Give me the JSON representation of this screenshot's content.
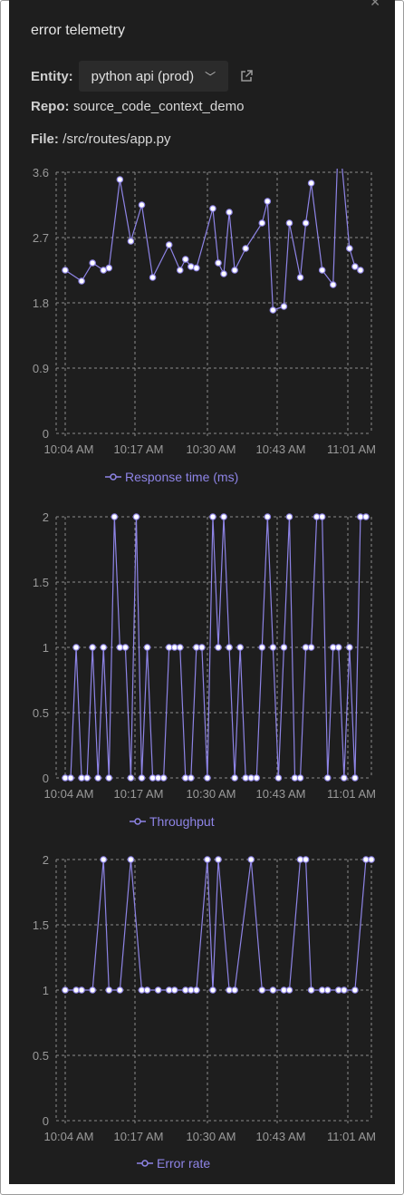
{
  "header": {
    "title": "error telemetry",
    "entity_label": "Entity:",
    "entity_value": "python api (prod)",
    "repo_label": "Repo:",
    "repo_value": "source_code_context_demo",
    "file_label": "File:",
    "file_value": "/src/routes/app.py"
  },
  "colors": {
    "series": "#8e84e6",
    "grid": "#8c8c8c",
    "text": "#9a9a9a",
    "background": "#1e1e1e"
  },
  "chart_data": [
    {
      "type": "line",
      "series": [
        {
          "name": "Response time (ms)",
          "x": [
            0,
            3,
            5,
            7,
            8,
            10,
            12,
            14,
            16,
            19,
            21,
            22,
            23,
            24,
            27,
            28,
            29,
            30,
            31,
            33,
            36,
            37,
            38,
            40,
            41,
            43,
            44,
            45,
            47,
            49,
            50,
            52,
            53,
            54
          ],
          "y": [
            2.25,
            2.1,
            2.35,
            2.25,
            2.28,
            3.5,
            2.65,
            3.15,
            2.15,
            2.6,
            2.25,
            2.4,
            2.3,
            2.28,
            3.1,
            2.35,
            2.2,
            3.05,
            2.25,
            2.55,
            2.9,
            3.2,
            1.7,
            1.75,
            2.9,
            2.15,
            2.9,
            3.45,
            2.25,
            2.05,
            4.2,
            2.55,
            2.3,
            2.25
          ]
        }
      ],
      "x_tick_labels": [
        "10:04 AM",
        "10:17 AM",
        "10:30 AM",
        "10:43 AM",
        "11:01 AM"
      ],
      "y_tick_labels": [
        "0",
        "0.9",
        "1.8",
        "2.7",
        "3.6"
      ],
      "ylim": [
        0,
        3.6
      ],
      "grid": true,
      "legend": "bottom"
    },
    {
      "type": "line",
      "series": [
        {
          "name": "Throughput",
          "x": [
            0,
            1,
            2,
            3,
            4,
            5,
            6,
            7,
            8,
            9,
            10,
            11,
            12,
            13,
            14,
            15,
            16,
            17,
            18,
            19,
            20,
            21,
            22,
            23,
            24,
            25,
            26,
            27,
            28,
            29,
            30,
            31,
            32,
            33,
            34,
            35,
            36,
            37,
            38,
            39,
            40,
            41,
            42,
            43,
            44,
            45,
            46,
            47,
            48,
            49,
            50,
            51,
            52,
            53,
            54,
            55
          ],
          "y": [
            0,
            0,
            1,
            0,
            0,
            1,
            0,
            1,
            0,
            2,
            1,
            1,
            0,
            2,
            0,
            1,
            0,
            0,
            0,
            1,
            1,
            1,
            0,
            0,
            1,
            1,
            0,
            2,
            1,
            2,
            1,
            0,
            1,
            0,
            0,
            0,
            1,
            2,
            1,
            0,
            1,
            2,
            0,
            0,
            1,
            1,
            2,
            2,
            0,
            1,
            1,
            0,
            1,
            0,
            2,
            2
          ]
        }
      ],
      "x_tick_labels": [
        "10:04 AM",
        "10:17 AM",
        "10:30 AM",
        "10:43 AM",
        "11:01 AM"
      ],
      "y_tick_labels": [
        "0",
        "0.5",
        "1",
        "1.5",
        "2"
      ],
      "ylim": [
        0,
        2
      ],
      "grid": true,
      "legend": "bottom"
    },
    {
      "type": "line",
      "series": [
        {
          "name": "Error rate",
          "x": [
            0,
            2,
            3,
            5,
            7,
            8,
            10,
            12,
            14,
            15,
            17,
            19,
            20,
            22,
            23,
            24,
            26,
            27,
            28,
            30,
            31,
            34,
            36,
            38,
            40,
            41,
            43,
            44,
            45,
            47,
            48,
            50,
            51,
            53,
            55,
            56
          ],
          "y": [
            1,
            1,
            1,
            1,
            2,
            1,
            1,
            2,
            1,
            1,
            1,
            1,
            1,
            1,
            1,
            1,
            2,
            1,
            2,
            1,
            1,
            2,
            1,
            1,
            1,
            1,
            2,
            2,
            1,
            1,
            1,
            1,
            1,
            1,
            2,
            2
          ]
        }
      ],
      "x_tick_labels": [
        "10:04 AM",
        "10:17 AM",
        "10:30 AM",
        "10:43 AM",
        "11:01 AM"
      ],
      "y_tick_labels": [
        "0",
        "0.5",
        "1",
        "1.5",
        "2"
      ],
      "ylim": [
        0,
        2
      ],
      "grid": true,
      "legend": "bottom"
    }
  ]
}
